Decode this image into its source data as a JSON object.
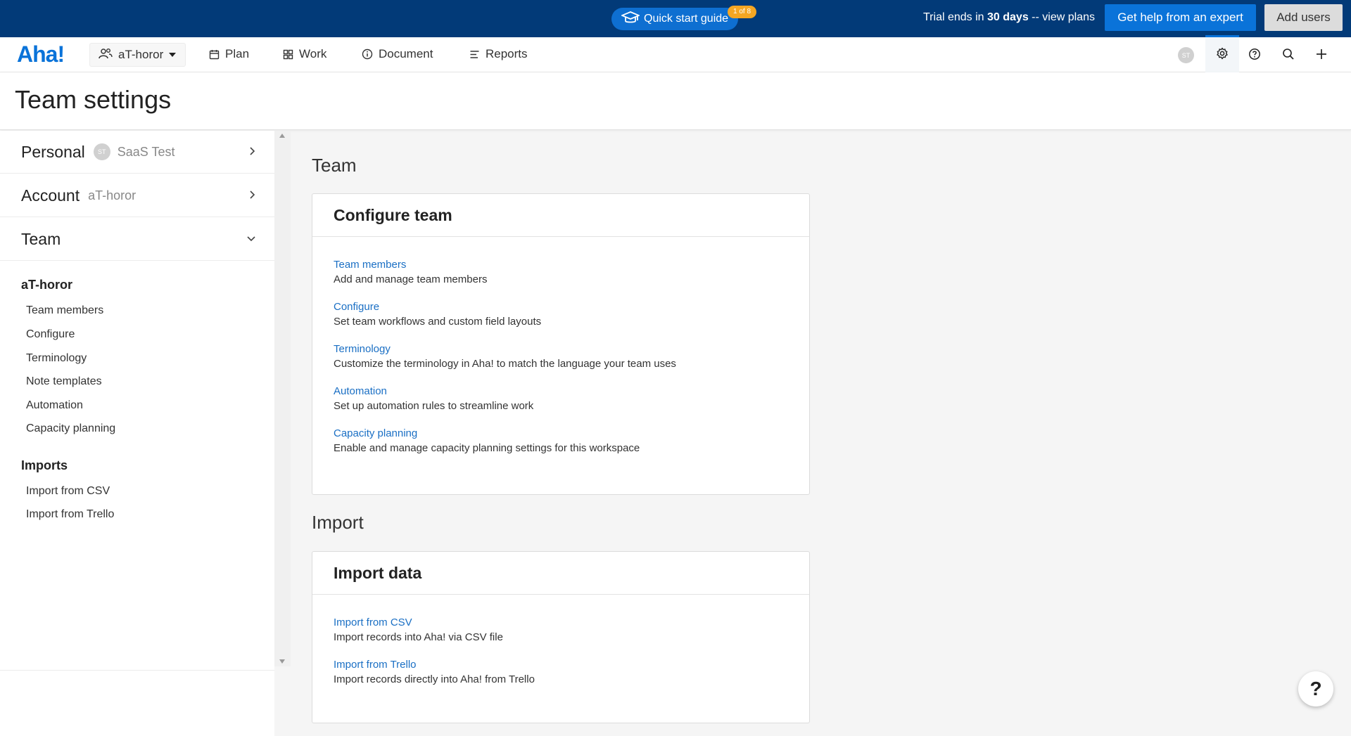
{
  "banner": {
    "quick_start_label": "Quick start guide",
    "quick_start_badge": "1 of 8",
    "trial_prefix": "Trial ends in ",
    "trial_days": "30 days",
    "trial_suffix": " -- view plans",
    "expert_button": "Get help from an expert",
    "add_users_button": "Add users"
  },
  "nav": {
    "logo": "Aha!",
    "workspace": "aT-horor",
    "items": [
      {
        "label": "Plan",
        "icon": "calendar-icon"
      },
      {
        "label": "Work",
        "icon": "grid-icon"
      },
      {
        "label": "Document",
        "icon": "info-circle-icon"
      },
      {
        "label": "Reports",
        "icon": "report-icon"
      }
    ],
    "user_initials": "ST"
  },
  "page": {
    "title": "Team settings"
  },
  "sidebar": {
    "personal": {
      "label": "Personal",
      "initials": "ST",
      "sub": "SaaS Test"
    },
    "account": {
      "label": "Account",
      "sub": "aT-horor"
    },
    "team": {
      "label": "Team"
    },
    "groups": [
      {
        "title": "aT-horor",
        "links": [
          "Team members",
          "Configure",
          "Terminology",
          "Note templates",
          "Automation",
          "Capacity planning"
        ]
      },
      {
        "title": "Imports",
        "links": [
          "Import from CSV",
          "Import from Trello"
        ]
      }
    ]
  },
  "main": {
    "sections": [
      {
        "title": "Team",
        "card_title": "Configure team",
        "entries": [
          {
            "link": "Team members",
            "desc": "Add and manage team members"
          },
          {
            "link": "Configure",
            "desc": "Set team workflows and custom field layouts"
          },
          {
            "link": "Terminology",
            "desc": "Customize the terminology in Aha! to match the language your team uses"
          },
          {
            "link": "Automation",
            "desc": "Set up automation rules to streamline work"
          },
          {
            "link": "Capacity planning",
            "desc": "Enable and manage capacity planning settings for this workspace"
          }
        ]
      },
      {
        "title": "Import",
        "card_title": "Import data",
        "entries": [
          {
            "link": "Import from CSV",
            "desc": "Import records into Aha! via CSV file"
          },
          {
            "link": "Import from Trello",
            "desc": "Import records directly into Aha! from Trello"
          }
        ]
      }
    ]
  },
  "help_fab": "?",
  "colors": {
    "banner_bg": "#023a78",
    "accent": "#0a73d9",
    "link": "#1a6fc4",
    "badge": "#f5a623"
  }
}
